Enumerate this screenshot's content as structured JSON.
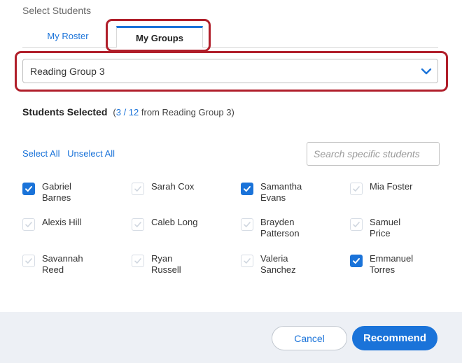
{
  "dialog": {
    "title": "Select Students"
  },
  "tabs": [
    {
      "label": "My Roster",
      "active": false
    },
    {
      "label": "My Groups",
      "active": true
    }
  ],
  "group_select": {
    "value": "Reading Group 3",
    "icon": "chevron-down-icon"
  },
  "summary": {
    "heading": "Students Selected",
    "open_paren": "(",
    "selected_count": "3",
    "slash": " / ",
    "total_count": "12",
    "source_text": " from Reading Group 3)"
  },
  "links": {
    "select_all": "Select All",
    "unselect_all": "Unselect All"
  },
  "search": {
    "placeholder": "Search specific students",
    "value": ""
  },
  "students": [
    {
      "name": "Gabriel Barnes",
      "checked": true
    },
    {
      "name": "Sarah Cox",
      "checked": false
    },
    {
      "name": "Samantha Evans",
      "checked": true
    },
    {
      "name": "Mia Foster",
      "checked": false
    },
    {
      "name": "Alexis Hill",
      "checked": false
    },
    {
      "name": "Caleb Long",
      "checked": false
    },
    {
      "name": "Brayden Patterson",
      "checked": false
    },
    {
      "name": "Samuel Price",
      "checked": false
    },
    {
      "name": "Savannah Reed",
      "checked": false
    },
    {
      "name": "Ryan Russell",
      "checked": false
    },
    {
      "name": "Valeria Sanchez",
      "checked": false
    },
    {
      "name": "Emmanuel Torres",
      "checked": true
    }
  ],
  "footer": {
    "cancel_label": "Cancel",
    "recommend_label": "Recommend"
  },
  "colors": {
    "accent": "#1a73d9",
    "highlight": "#b01e2a",
    "footer_bg": "#edf0f5"
  }
}
